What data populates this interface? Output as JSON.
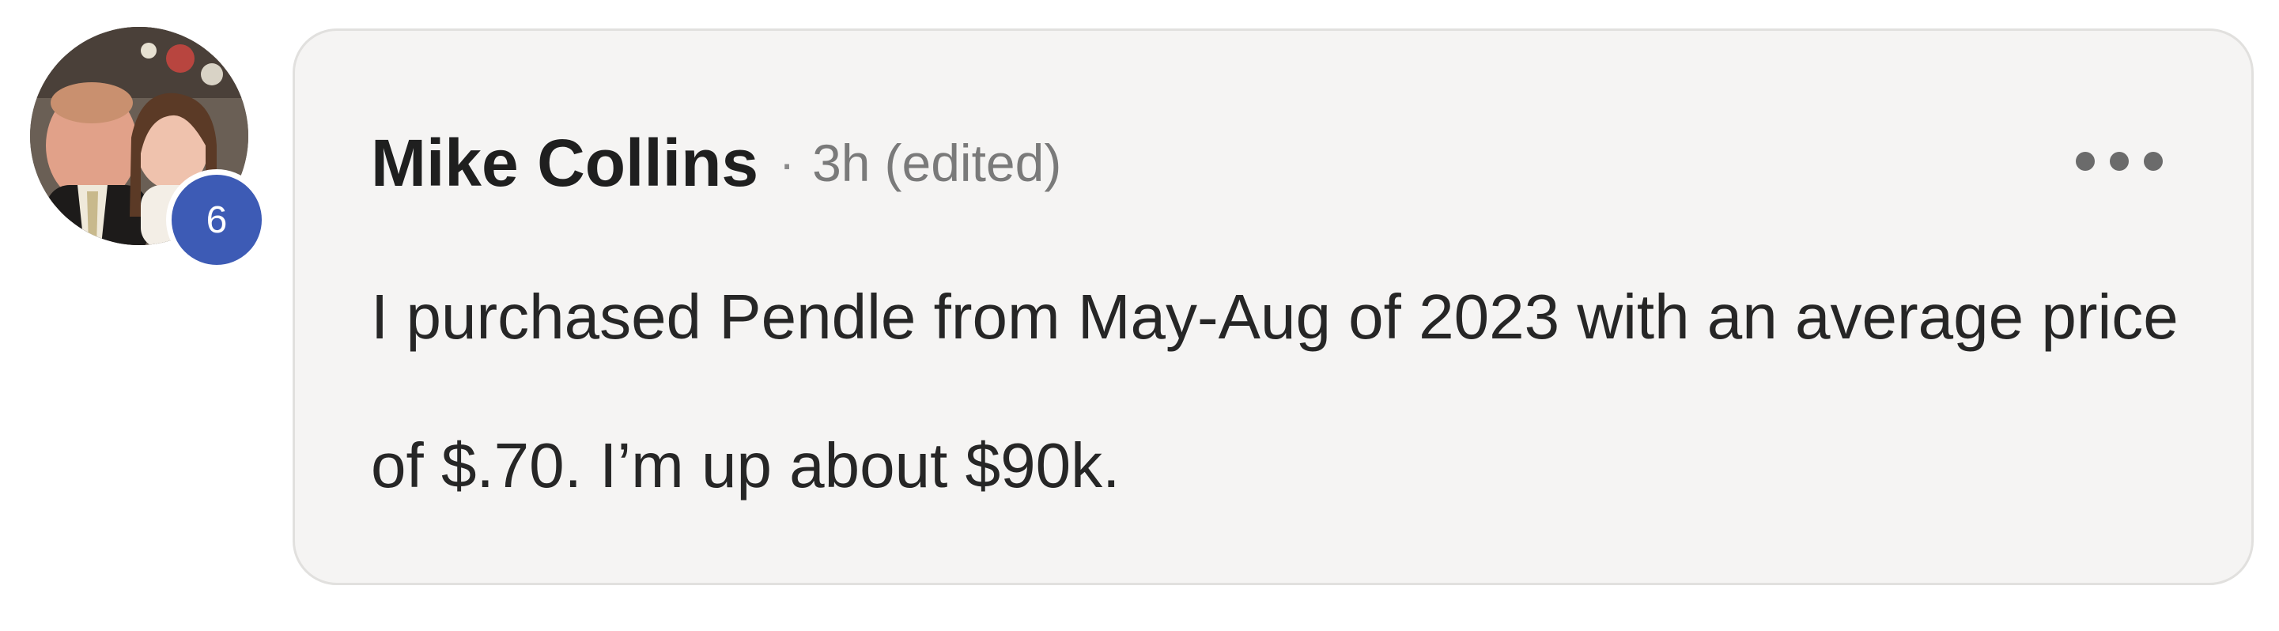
{
  "comment": {
    "author": {
      "name": "Mike Collins",
      "badge_count": "6"
    },
    "meta": {
      "separator": "·",
      "time": "3h",
      "edited_label": "(edited)"
    },
    "body": "I purchased Pendle from May-Aug of 2023 with an average price of $.70. I’m up about $90k.",
    "more_options_icon": "more-horizontal-icon"
  },
  "colors": {
    "bubble_background": "#f5f4f3",
    "badge": "#3d5bb5",
    "meta_text": "#7a7a7a"
  }
}
